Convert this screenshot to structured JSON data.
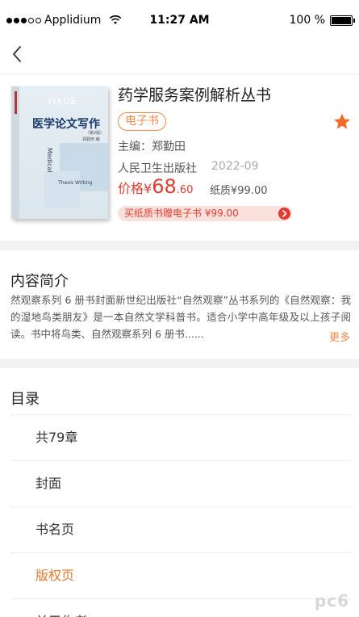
{
  "status_bar": {
    "carrier": "Applidium",
    "time": "11:27 AM",
    "battery": "100 %"
  },
  "navbar": {
    "back_icon": "chevron-left-icon"
  },
  "book": {
    "title": "药学服务案例解析丛书",
    "format_tag": "电子书",
    "favorite_icon": "star-icon",
    "favorite_color": "#f06a2a",
    "editor": "主编：郑勤田",
    "publisher": "人民卫生出版社",
    "pub_date": "2022-09",
    "price_label": "价格¥",
    "price_integer": "68",
    "price_decimal": ".60",
    "paper_price": "纸质¥99.00",
    "promo_text": "买纸质书赠电子书 ¥99.00",
    "cover": {
      "latin": "YIXUE",
      "title": "医学论文写作",
      "edition": "（第2版）",
      "author": "郑勤田 编",
      "medical": "Medical",
      "thesis": "Thesis Writing"
    }
  },
  "intro": {
    "heading": "内容简介",
    "text": "然观察系列 6 册书封面新世纪出版社“自然观察”丛书系列的《自然观察：我的湿地鸟类朋友》是一本自然文学科普书。适合小学中高年级及以上孩子阅读。书中将鸟类、自然观察系列 6 册书......",
    "more": "更多"
  },
  "toc": {
    "heading": "目录",
    "items": [
      {
        "label": "共79章",
        "active": false
      },
      {
        "label": "封面",
        "active": false
      },
      {
        "label": "书名页",
        "active": false
      },
      {
        "label": "版权页",
        "active": true
      },
      {
        "label": "关于作者",
        "active": false
      }
    ]
  },
  "watermark": "pc6",
  "colors": {
    "accent_orange": "#f08a4b",
    "price_red": "#e03c31",
    "active_item": "#e5792f"
  }
}
